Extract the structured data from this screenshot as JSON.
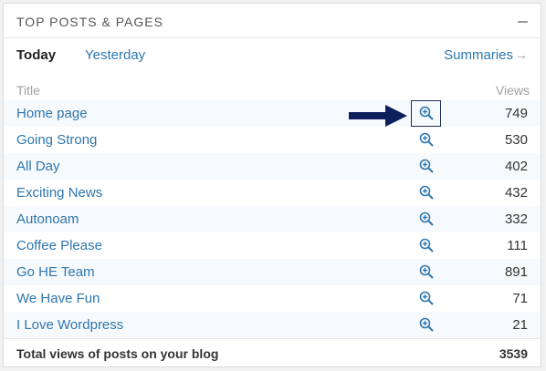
{
  "widget": {
    "title": "TOP POSTS & PAGES",
    "tabs": {
      "today": "Today",
      "yesterday": "Yesterday",
      "summaries": "Summaries"
    },
    "columns": {
      "title": "Title",
      "views": "Views"
    },
    "rows": [
      {
        "title": "Home page",
        "views": "749"
      },
      {
        "title": "Going Strong",
        "views": "530"
      },
      {
        "title": "All Day",
        "views": "402"
      },
      {
        "title": "Exciting News",
        "views": "432"
      },
      {
        "title": "Autonoam",
        "views": "332"
      },
      {
        "title": "Coffee Please",
        "views": "111"
      },
      {
        "title": "Go HE Team",
        "views": "891"
      },
      {
        "title": "We Have Fun",
        "views": "71"
      },
      {
        "title": "I Love Wordpress",
        "views": "21"
      }
    ],
    "total": {
      "label": "Total views of posts on your blog",
      "value": "3539"
    }
  },
  "colors": {
    "link": "#2e76ad",
    "arrow": "#0d1f5c"
  },
  "icons": {
    "zoom": "magnifier-plus-icon",
    "collapse": "minus-icon",
    "summaries_arrow": "right-arrow-icon",
    "pointer": "pointer-arrow-icon"
  }
}
